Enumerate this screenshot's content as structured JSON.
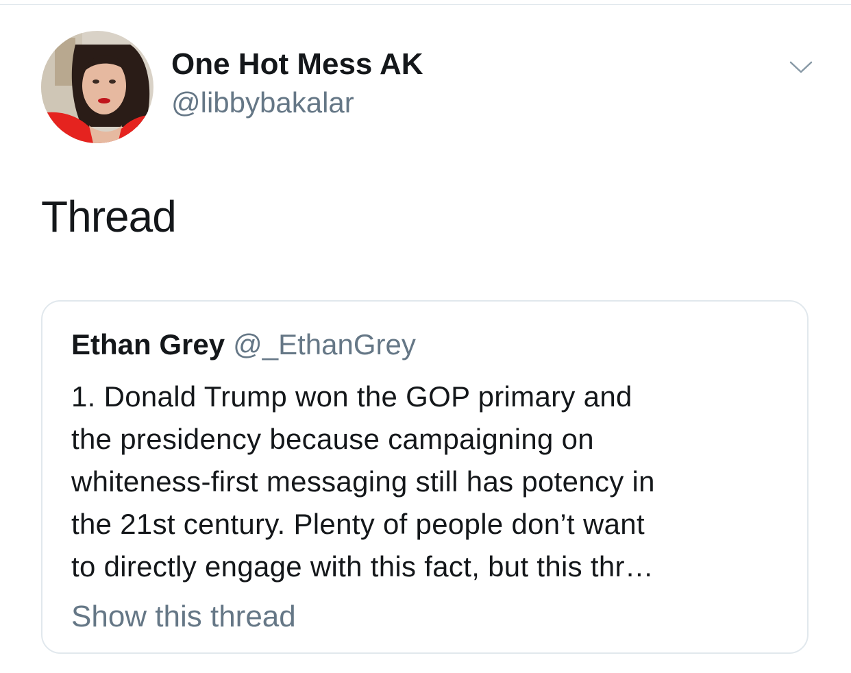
{
  "tweet": {
    "author": {
      "display_name": "One Hot Mess AK",
      "handle": "@libbybakalar",
      "avatar_icon": "profile-photo"
    },
    "menu_icon": "chevron-down-icon",
    "text": "Thread"
  },
  "quoted_tweet": {
    "display_name": "Ethan Grey",
    "handle": "@_EthanGrey",
    "lines": [
      "1. Donald Trump won the GOP primary and",
      "the presidency because campaigning on",
      "whiteness-first messaging still has potency in",
      "the 21st century. Plenty of people don’t want",
      "to directly engage with this fact, but this thr…"
    ],
    "show_thread_label": "Show this thread"
  },
  "colors": {
    "text_primary": "#14171a",
    "text_secondary": "#657786",
    "border": "#e1e8ed"
  }
}
